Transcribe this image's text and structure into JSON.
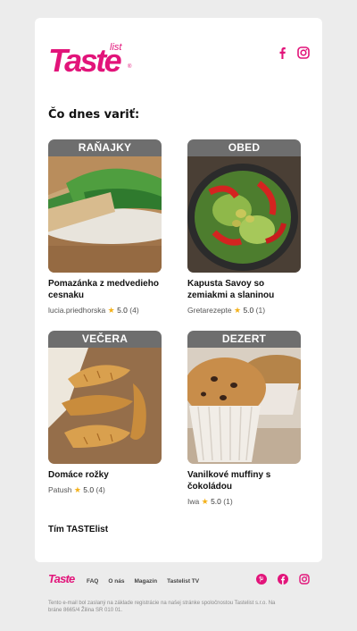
{
  "brand": {
    "logo_text": "Taste",
    "logo_sub": "list",
    "logo_reg": "®",
    "color": "#e2147a"
  },
  "header": {
    "social_icons": [
      "facebook-icon",
      "instagram-icon"
    ]
  },
  "main": {
    "heading": "Čo dnes variť:",
    "recipes": [
      {
        "category": "RAŇAJKY",
        "title": "Pomazánka z medvedieho cesnaku",
        "author": "lucia.priedhorska",
        "rating": "5.0",
        "count": "(4)"
      },
      {
        "category": "OBED",
        "title": "Kapusta Savoy so zemiakmi a slaninou",
        "author": "Gretarezepte",
        "rating": "5.0",
        "count": "(1)"
      },
      {
        "category": "VEČERA",
        "title": "Domáce rožky",
        "author": "Patush",
        "rating": "5.0",
        "count": "(4)"
      },
      {
        "category": "DEZERT",
        "title": "Vanilkové muffiny s čokoládou",
        "author": "Iwa",
        "rating": "5.0",
        "count": "(1)"
      }
    ],
    "signoff": "Tím TASTElist"
  },
  "footer": {
    "logo_text": "Taste",
    "nav": [
      "FAQ",
      "O nás",
      "Magazín",
      "Tastelist TV"
    ],
    "social_icons": [
      "pinterest-icon",
      "facebook-icon",
      "instagram-icon"
    ],
    "legal": "Tento e-mail bol zaslaný na základe registrácie na našej stránke spoločnostou Tastelist s.r.o. Na bráne 8665/4 Žilina SR 010 01."
  },
  "colors": {
    "accent": "#e2147a",
    "tab_bg": "#6e6e6e",
    "star": "#f3b11b",
    "page_bg": "#ececec"
  }
}
